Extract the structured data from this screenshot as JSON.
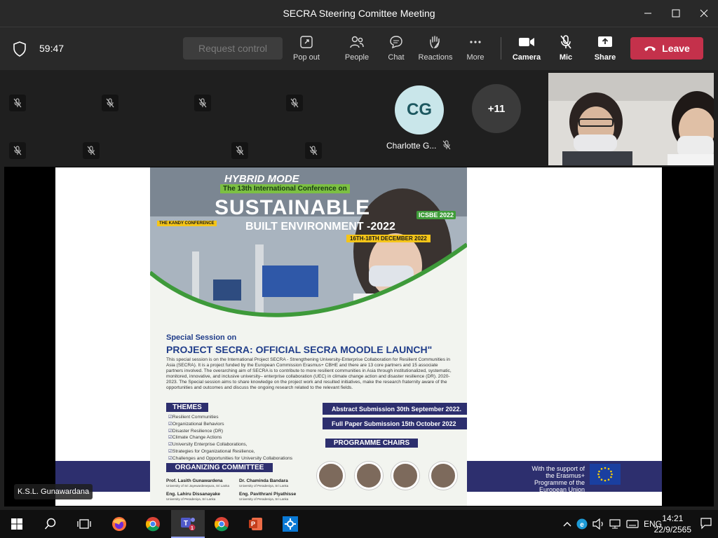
{
  "window": {
    "title": "SECRA Steering Comittee Meeting"
  },
  "toolbar": {
    "timer": "59:47",
    "request_control": "Request control",
    "items": [
      {
        "label": "Pop out"
      },
      {
        "label": "People"
      },
      {
        "label": "Chat"
      },
      {
        "label": "Reactions"
      },
      {
        "label": "More"
      },
      {
        "label": "Camera"
      },
      {
        "label": "Mic"
      },
      {
        "label": "Share"
      }
    ],
    "leave": "Leave"
  },
  "participants": {
    "avatar_initials": "CG",
    "avatar_name": "Charlotte G...",
    "overflow": "+11"
  },
  "stage": {
    "speaker": "K.S.L. Gunawardana"
  },
  "poster": {
    "hybrid_a": "HYBRID",
    "hybrid_b": " MODE",
    "conf": "The 13th International Conference on",
    "title": "SUSTAINABLE",
    "subtitle": "BUILT ENVIRONMENT -2022",
    "dates": "16TH-18TH DECEMBER 2022",
    "kandy": "THE KANDY CONFERENCE",
    "icsbe": "ICSBE 2022",
    "special": "Special Session on",
    "project": "PROJECT SECRA: OFFICIAL SECRA MOODLE LAUNCH\"",
    "paragraph": "This special session is on the International Project SECRA - Strengthening University-Enterprise Collaboration for Resilient Communities in Asia (SECRA). It is a project funded by the European Commission Erasmus+ CBHE and there are 13 core partners and 15 associate partners involved. The overarching aim of SECRA is to contribute to more resilient communities in Asia through institutionalized, systematic, monitored, innovative, and inclusive university– enterprise collaboration (UEC) in climate change action and disaster resilience (DR). 2020- 2023.  The Special session aims to share knowledge on the project work and resulted initiatives, make the research fraternity aware of the opportunities and outcomes and discuss the ongoing research related to the relevant fields.",
    "themes_heading": "THEMES",
    "themes": [
      "Resilient Communities",
      "Organizational Behaviors",
      "Disaster Resilience (DR)",
      "Climate Change Actions",
      "University Enterprise Collaborations,",
      "Strategies for Organizational Resilience,",
      "Challenges and Opportunities for University Collaborations"
    ],
    "abstract": "Abstract Submission 30th September 2022.",
    "fullpaper": "Full Paper Submission 15th October 2022",
    "chairs_heading": "PROGRAMME CHAIRS",
    "org_heading": "ORGANIZING COMMITTEE",
    "members": [
      {
        "name": "Prof. Lasith Gunawardena",
        "aff": "University of Sri Jayewardenepura, Sri Lanka"
      },
      {
        "name": "Dr. Chaminda Bandara",
        "aff": "University of Peradeniya, Sri Lanka"
      },
      {
        "name": "Eng. Lahiru Dissanayake",
        "aff": "University of Peradeniya, Sri Lanka"
      },
      {
        "name": "Eng. Pavithrani Piyathisse",
        "aff": "University of Peradeniya, Sri Lanka"
      }
    ],
    "eu_support": "With the support of the Erasmus+ Programme of the European Union"
  },
  "taskbar": {
    "lang": "ENG",
    "time": "14:21",
    "date": "22/9/2565"
  }
}
